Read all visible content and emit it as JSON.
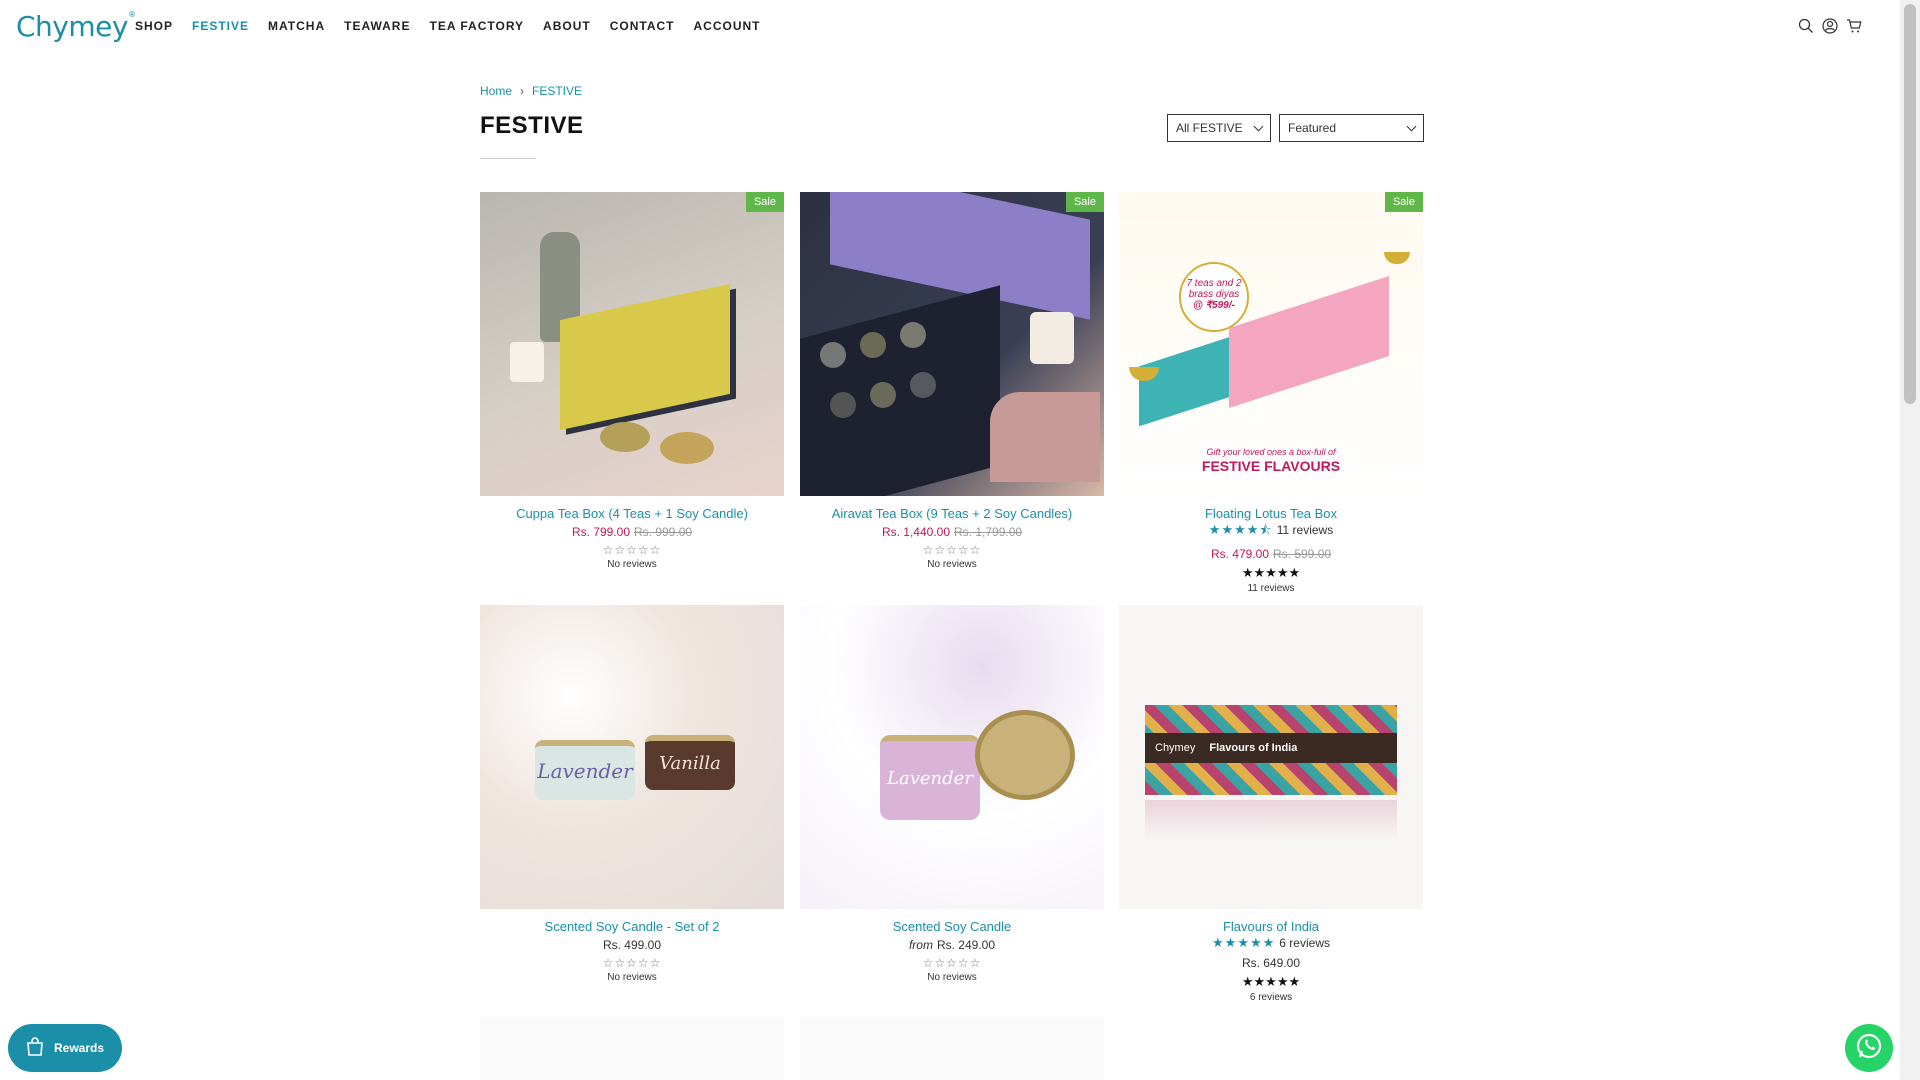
{
  "header": {
    "logo": "Chymey",
    "nav": [
      "SHOP",
      "FESTIVE",
      "MATCHA",
      "TEAWARE",
      "TEA FACTORY",
      "ABOUT",
      "CONTACT",
      "ACCOUNT"
    ],
    "active_nav": "FESTIVE",
    "icons": [
      "search-icon",
      "account-icon",
      "cart-icon"
    ]
  },
  "breadcrumb": {
    "home": "Home",
    "current": "FESTIVE"
  },
  "page_title": "FESTIVE",
  "filters": {
    "collection": "All FESTIVE",
    "sort": "Featured"
  },
  "products": [
    {
      "name": "Cuppa Tea Box (4 Teas + 1 Soy Candle)",
      "price": "Rs. 799.00",
      "compare": "Rs. 999.00",
      "sale": "Sale",
      "reviews": "No reviews"
    },
    {
      "name": "Airavat Tea Box (9 Teas + 2 Soy Candles)",
      "price": "Rs. 1,440.00",
      "compare": "Rs. 1,799.00",
      "sale": "Sale",
      "reviews": "No reviews"
    },
    {
      "name": "Floating Lotus Tea Box",
      "price": "Rs. 479.00",
      "compare": "Rs. 599.00",
      "sale": "Sale",
      "rating_text": "11 reviews",
      "reviews": "11 reviews",
      "rating": 4.5,
      "image_text": [
        "7 teas and 2",
        "brass diyas",
        "@ ₹599/-",
        "Gift your loved ones a box-full of",
        "FESTIVE FLAVOURS"
      ]
    },
    {
      "name": "Scented Soy Candle - Set of 2",
      "price": "Rs. 499.00",
      "reviews": "No reviews",
      "image_text": [
        "Lavender",
        "Vanilla"
      ]
    },
    {
      "name": "Scented Soy Candle",
      "from": "from",
      "price": "Rs. 249.00",
      "reviews": "No reviews",
      "image_text": [
        "Lavender"
      ]
    },
    {
      "name": "Flavours of India",
      "price": "Rs. 649.00",
      "rating_text": "6 reviews",
      "reviews": "6 reviews",
      "rating": 5,
      "image_text": [
        "Chymey",
        "Flavours of India"
      ]
    }
  ],
  "widgets": {
    "rewards": "Rewards"
  },
  "colors": {
    "accent": "#1b8fa8",
    "sale": "#5fb74a",
    "price": "#c2185b"
  }
}
